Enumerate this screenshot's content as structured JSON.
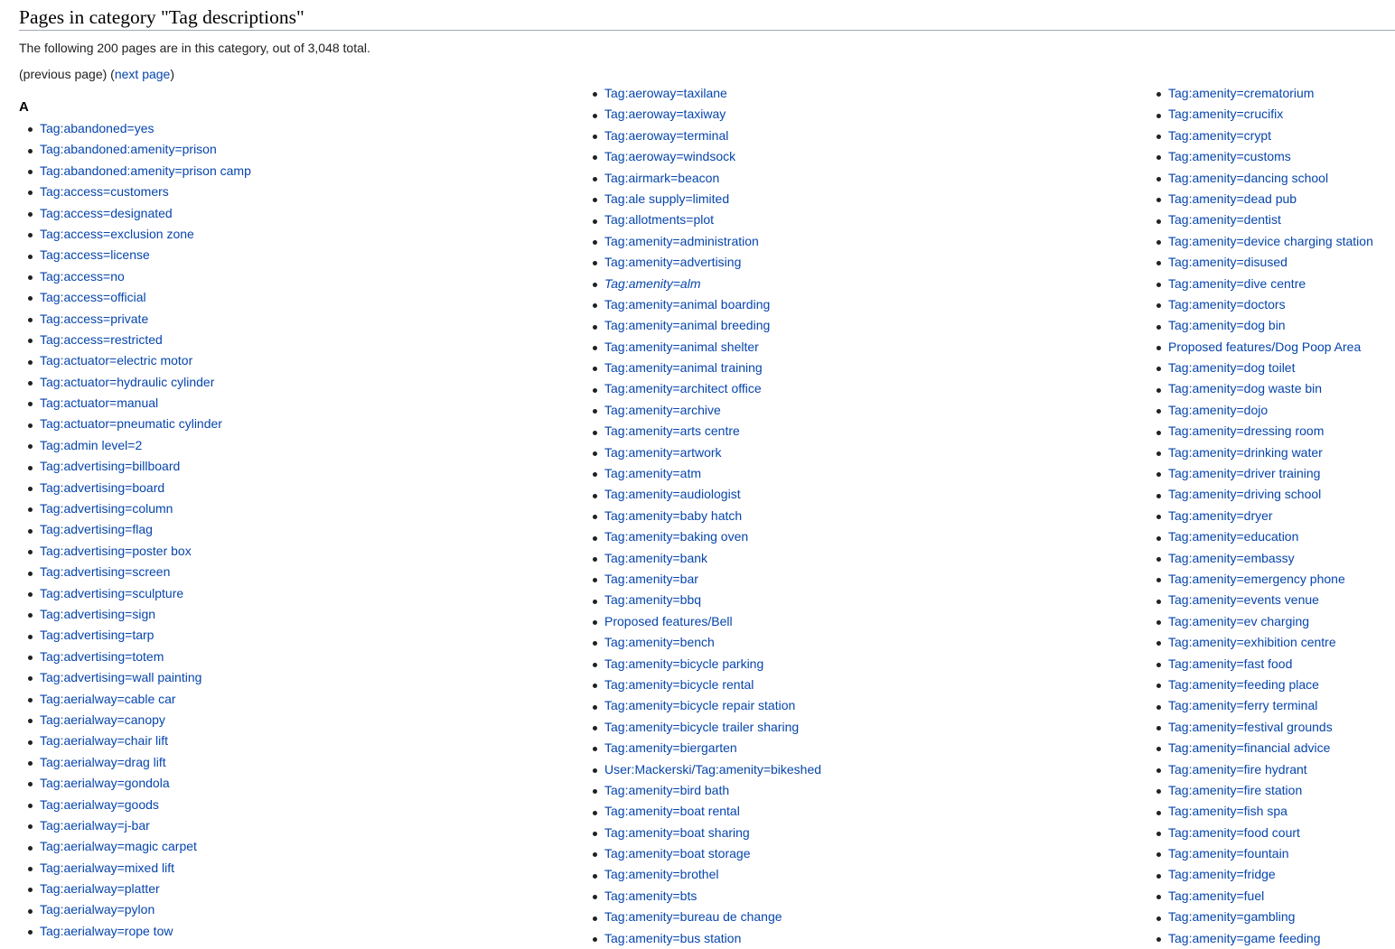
{
  "title": "Pages in category \"Tag descriptions\"",
  "summary": "The following 200 pages are in this category, out of 3,048 total.",
  "pager": {
    "prev": "(previous page)",
    "next_open": "(",
    "next": "next page",
    "next_close": ")"
  },
  "section_letter": "A",
  "columns": [
    [
      "Tag:abandoned=yes",
      "Tag:abandoned:amenity=prison",
      "Tag:abandoned:amenity=prison camp",
      "Tag:access=customers",
      "Tag:access=designated",
      "Tag:access=exclusion zone",
      "Tag:access=license",
      "Tag:access=no",
      "Tag:access=official",
      "Tag:access=private",
      "Tag:access=restricted",
      "Tag:actuator=electric motor",
      "Tag:actuator=hydraulic cylinder",
      "Tag:actuator=manual",
      "Tag:actuator=pneumatic cylinder",
      "Tag:admin level=2",
      "Tag:advertising=billboard",
      "Tag:advertising=board",
      "Tag:advertising=column",
      "Tag:advertising=flag",
      "Tag:advertising=poster box",
      "Tag:advertising=screen",
      "Tag:advertising=sculpture",
      "Tag:advertising=sign",
      "Tag:advertising=tarp",
      "Tag:advertising=totem",
      "Tag:advertising=wall painting",
      "Tag:aerialway=cable car",
      "Tag:aerialway=canopy",
      "Tag:aerialway=chair lift",
      "Tag:aerialway=drag lift",
      "Tag:aerialway=gondola",
      "Tag:aerialway=goods",
      "Tag:aerialway=j-bar",
      "Tag:aerialway=magic carpet",
      "Tag:aerialway=mixed lift",
      "Tag:aerialway=platter",
      "Tag:aerialway=pylon",
      "Tag:aerialway=rope tow"
    ],
    [
      "Tag:aeroway=taxilane",
      "Tag:aeroway=taxiway",
      "Tag:aeroway=terminal",
      "Tag:aeroway=windsock",
      "Tag:airmark=beacon",
      "Tag:ale supply=limited",
      "Tag:allotments=plot",
      "Tag:amenity=administration",
      "Tag:amenity=advertising",
      "Tag:amenity=alm",
      "Tag:amenity=animal boarding",
      "Tag:amenity=animal breeding",
      "Tag:amenity=animal shelter",
      "Tag:amenity=animal training",
      "Tag:amenity=architect office",
      "Tag:amenity=archive",
      "Tag:amenity=arts centre",
      "Tag:amenity=artwork",
      "Tag:amenity=atm",
      "Tag:amenity=audiologist",
      "Tag:amenity=baby hatch",
      "Tag:amenity=baking oven",
      "Tag:amenity=bank",
      "Tag:amenity=bar",
      "Tag:amenity=bbq",
      "Proposed features/Bell",
      "Tag:amenity=bench",
      "Tag:amenity=bicycle parking",
      "Tag:amenity=bicycle rental",
      "Tag:amenity=bicycle repair station",
      "Tag:amenity=bicycle trailer sharing",
      "Tag:amenity=biergarten",
      "User:Mackerski/Tag:amenity=bikeshed",
      "Tag:amenity=bird bath",
      "Tag:amenity=boat rental",
      "Tag:amenity=boat sharing",
      "Tag:amenity=boat storage",
      "Tag:amenity=brothel",
      "Tag:amenity=bts",
      "Tag:amenity=bureau de change",
      "Tag:amenity=bus station"
    ],
    [
      "Tag:amenity=crematorium",
      "Tag:amenity=crucifix",
      "Tag:amenity=crypt",
      "Tag:amenity=customs",
      "Tag:amenity=dancing school",
      "Tag:amenity=dead pub",
      "Tag:amenity=dentist",
      "Tag:amenity=device charging station",
      "Tag:amenity=disused",
      "Tag:amenity=dive centre",
      "Tag:amenity=doctors",
      "Tag:amenity=dog bin",
      "Proposed features/Dog Poop Area",
      "Tag:amenity=dog toilet",
      "Tag:amenity=dog waste bin",
      "Tag:amenity=dojo",
      "Tag:amenity=dressing room",
      "Tag:amenity=drinking water",
      "Tag:amenity=driver training",
      "Tag:amenity=driving school",
      "Tag:amenity=dryer",
      "Tag:amenity=education",
      "Tag:amenity=embassy",
      "Tag:amenity=emergency phone",
      "Tag:amenity=events venue",
      "Tag:amenity=ev charging",
      "Tag:amenity=exhibition centre",
      "Tag:amenity=fast food",
      "Tag:amenity=feeding place",
      "Tag:amenity=ferry terminal",
      "Tag:amenity=festival grounds",
      "Tag:amenity=financial advice",
      "Tag:amenity=fire hydrant",
      "Tag:amenity=fire station",
      "Tag:amenity=fish spa",
      "Tag:amenity=food court",
      "Tag:amenity=fountain",
      "Tag:amenity=fridge",
      "Tag:amenity=fuel",
      "Tag:amenity=gambling",
      "Tag:amenity=game feeding"
    ]
  ]
}
